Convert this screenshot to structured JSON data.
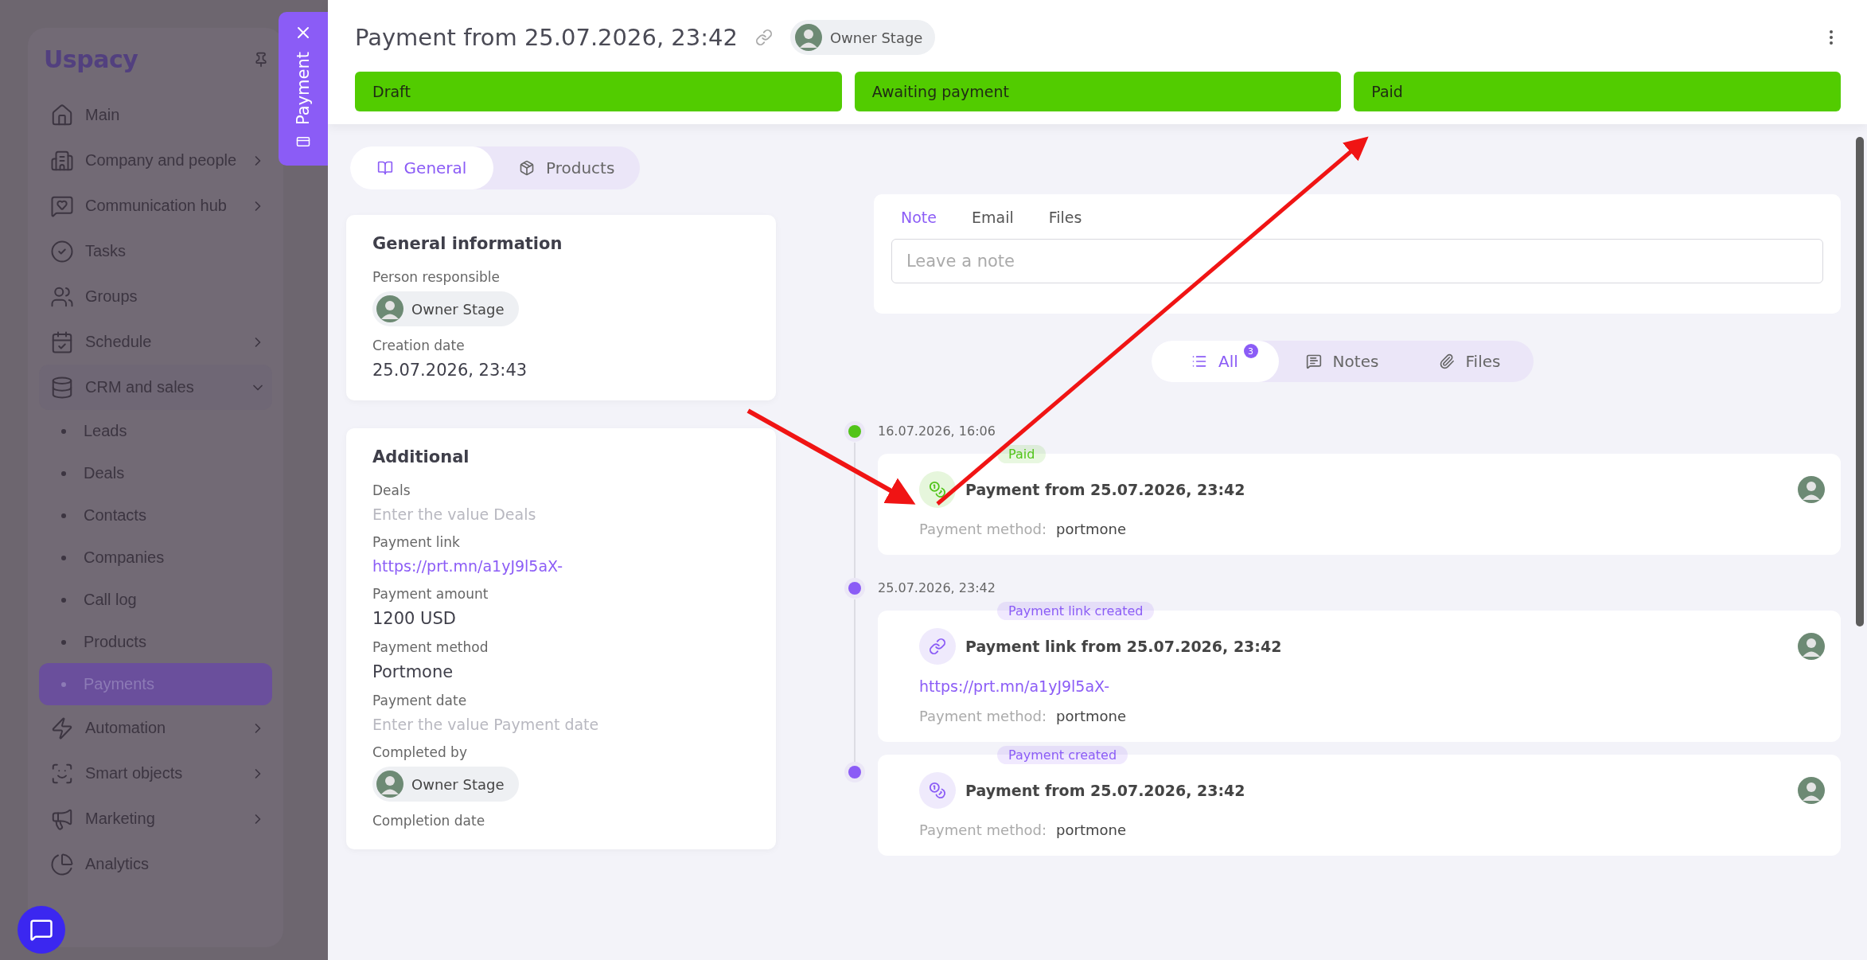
{
  "sidebar": {
    "logo": "Uspacy",
    "items": [
      {
        "kind": "link",
        "label": "Main"
      },
      {
        "kind": "group",
        "label": "Company and people",
        "expanded": false
      },
      {
        "kind": "group",
        "label": "Communication hub",
        "expanded": false
      },
      {
        "kind": "link",
        "label": "Tasks"
      },
      {
        "kind": "link",
        "label": "Groups"
      },
      {
        "kind": "group",
        "label": "Schedule",
        "expanded": false
      },
      {
        "kind": "group",
        "label": "CRM and sales",
        "expanded": true,
        "children": [
          {
            "label": "Leads",
            "selected": false
          },
          {
            "label": "Deals",
            "selected": false
          },
          {
            "label": "Contacts",
            "selected": false
          },
          {
            "label": "Companies",
            "selected": false
          },
          {
            "label": "Call log",
            "selected": false
          },
          {
            "label": "Products",
            "selected": false
          },
          {
            "label": "Payments",
            "selected": true
          }
        ]
      },
      {
        "kind": "group",
        "label": "Automation",
        "expanded": false
      },
      {
        "kind": "group",
        "label": "Smart objects",
        "expanded": false
      },
      {
        "kind": "group",
        "label": "Marketing",
        "expanded": false
      },
      {
        "kind": "link",
        "label": "Analytics"
      }
    ]
  },
  "side_tab": {
    "label": "Payment"
  },
  "header": {
    "title": "Payment from 25.07.2026, 23:42",
    "owner": "Owner Stage",
    "stages": [
      {
        "label": "Draft",
        "done": true
      },
      {
        "label": "Awaiting payment",
        "done": true
      },
      {
        "label": "Paid",
        "done": true
      }
    ]
  },
  "tabs": [
    {
      "label": "General",
      "selected": true
    },
    {
      "label": "Products",
      "selected": false
    }
  ],
  "cards": [
    {
      "title": "General information",
      "fields": [
        {
          "label": "Person responsible",
          "kind": "user",
          "value": "Owner Stage"
        },
        {
          "label": "Creation date",
          "kind": "text",
          "value": "25.07.2026, 23:43"
        }
      ]
    },
    {
      "title": "Additional",
      "fields": [
        {
          "label": "Deals",
          "kind": "empty",
          "placeholder": "Enter the value Deals"
        },
        {
          "label": "Payment link",
          "kind": "link",
          "value": "https://prt.mn/a1yJ9l5aX-"
        },
        {
          "label": "Payment amount",
          "kind": "text",
          "value": "1200 USD"
        },
        {
          "label": "Payment method",
          "kind": "text",
          "value": "Portmone"
        },
        {
          "label": "Payment date",
          "kind": "empty",
          "placeholder": "Enter the value Payment date"
        },
        {
          "label": "Completed by",
          "kind": "user",
          "value": "Owner Stage"
        },
        {
          "label": "Completion date",
          "kind": "label"
        }
      ]
    }
  ],
  "composer": {
    "tabs": [
      {
        "label": "Note",
        "selected": true
      },
      {
        "label": "Email",
        "selected": false
      },
      {
        "label": "Files",
        "selected": false
      }
    ],
    "placeholder": "Leave a note"
  },
  "filters": [
    {
      "label": "All",
      "count": "3",
      "selected": true
    },
    {
      "label": "Notes",
      "selected": false
    },
    {
      "label": "Files",
      "selected": false
    }
  ],
  "timeline": [
    {
      "date": "16.07.2026, 16:06",
      "color": "#52c41a",
      "badge": "Paid",
      "kind": "payment",
      "title": "Payment from 25.07.2026, 23:42",
      "method_label": "Payment method:",
      "method": "portmone"
    },
    {
      "date": "25.07.2026, 23:42",
      "color": "#8b5cf6",
      "badge": "Payment link created",
      "kind": "link",
      "title": "Payment link from 25.07.2026, 23:42",
      "link": "https://prt.mn/a1yJ9l5aX-",
      "method_label": "Payment method:",
      "method": "portmone"
    },
    {
      "color": "#8b5cf6",
      "badge": "Payment created",
      "kind": "payment",
      "title": "Payment from 25.07.2026, 23:42",
      "method_label": "Payment method:",
      "method": "portmone"
    }
  ]
}
